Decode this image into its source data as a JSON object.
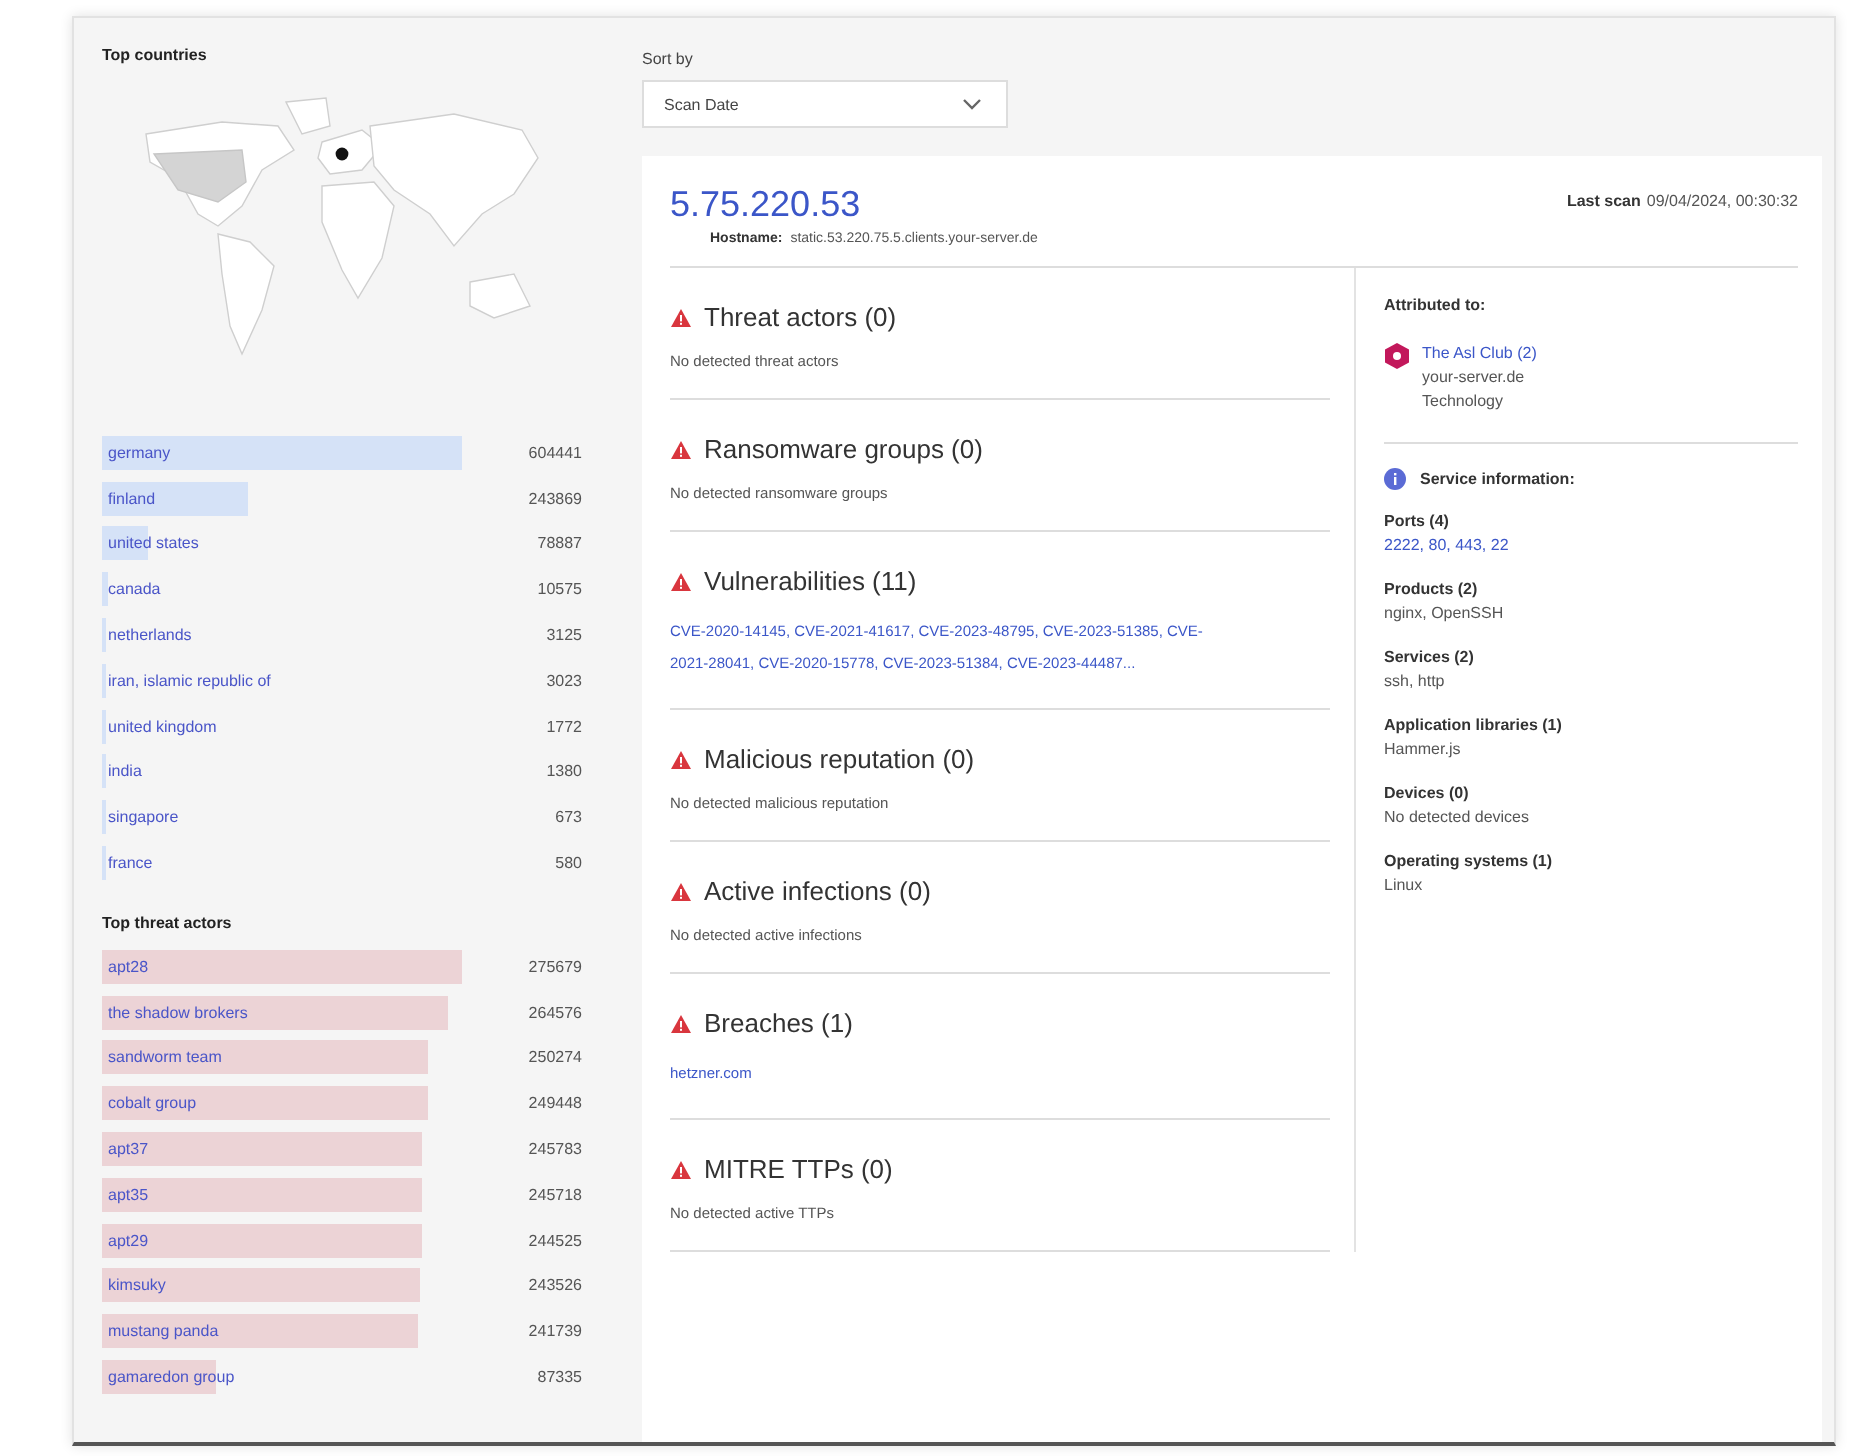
{
  "top_countries": {
    "title": "Top countries",
    "rows": [
      {
        "name": "germany",
        "count": "604441"
      },
      {
        "name": "finland",
        "count": "243869"
      },
      {
        "name": "united states",
        "count": "78887"
      },
      {
        "name": "canada",
        "count": "10575"
      },
      {
        "name": "netherlands",
        "count": "3125"
      },
      {
        "name": "iran, islamic republic of",
        "count": "3023"
      },
      {
        "name": "united kingdom",
        "count": "1772"
      },
      {
        "name": "india",
        "count": "1380"
      },
      {
        "name": "singapore",
        "count": "673"
      },
      {
        "name": "france",
        "count": "580"
      }
    ]
  },
  "top_threat_actors": {
    "title": "Top threat actors",
    "rows": [
      {
        "name": "apt28",
        "count": "275679"
      },
      {
        "name": "the shadow brokers",
        "count": "264576"
      },
      {
        "name": "sandworm team",
        "count": "250274"
      },
      {
        "name": "cobalt group",
        "count": "249448"
      },
      {
        "name": "apt37",
        "count": "245783"
      },
      {
        "name": "apt35",
        "count": "245718"
      },
      {
        "name": "apt29",
        "count": "244525"
      },
      {
        "name": "kimsuky",
        "count": "243526"
      },
      {
        "name": "mustang panda",
        "count": "241739"
      },
      {
        "name": "gamaredon group",
        "count": "87335"
      }
    ]
  },
  "sort": {
    "label": "Sort by",
    "value": "Scan Date"
  },
  "result": {
    "ip": "5.75.220.53",
    "hostname_label": "Hostname:",
    "hostname": "static.53.220.75.5.clients.your-server.de",
    "last_scan_label": "Last scan",
    "last_scan": "09/04/2024, 00:30:32",
    "sections": [
      {
        "title": "Threat actors (0)",
        "kind": "text",
        "text": "No detected threat actors"
      },
      {
        "title": "Ransomware groups (0)",
        "kind": "text",
        "text": "No detected ransomware groups"
      },
      {
        "title": "Vulnerabilities (11)",
        "kind": "links",
        "text": "CVE-2020-14145, CVE-2021-41617, CVE-2023-48795, CVE-2023-51385, CVE-2021-28041, CVE-2020-15778, CVE-2023-51384, CVE-2023-44487..."
      },
      {
        "title": "Malicious reputation (0)",
        "kind": "text",
        "text": "No detected malicious reputation"
      },
      {
        "title": "Active infections (0)",
        "kind": "text",
        "text": "No detected active infections"
      },
      {
        "title": "Breaches (1)",
        "kind": "links",
        "text": "hetzner.com"
      },
      {
        "title": "MITRE TTPs (0)",
        "kind": "text",
        "text": "No detected active TTPs"
      }
    ],
    "attribution": {
      "title": "Attributed to:",
      "name": "The Asl Club (2)",
      "domain": "your-server.de",
      "industry": "Technology"
    },
    "service": {
      "title": "Service information:",
      "groups": [
        {
          "label": "Ports (4)",
          "value": "2222, 80, 443, 22",
          "kind": "links"
        },
        {
          "label": "Products (2)",
          "value": "nginx, OpenSSH",
          "kind": "text"
        },
        {
          "label": "Services (2)",
          "value": "ssh, http",
          "kind": "text"
        },
        {
          "label": "Application libraries (1)",
          "value": "Hammer.js",
          "kind": "text"
        },
        {
          "label": "Devices (0)",
          "value": "No detected devices",
          "kind": "text"
        },
        {
          "label": "Operating systems (1)",
          "value": "Linux",
          "kind": "text"
        }
      ]
    }
  }
}
